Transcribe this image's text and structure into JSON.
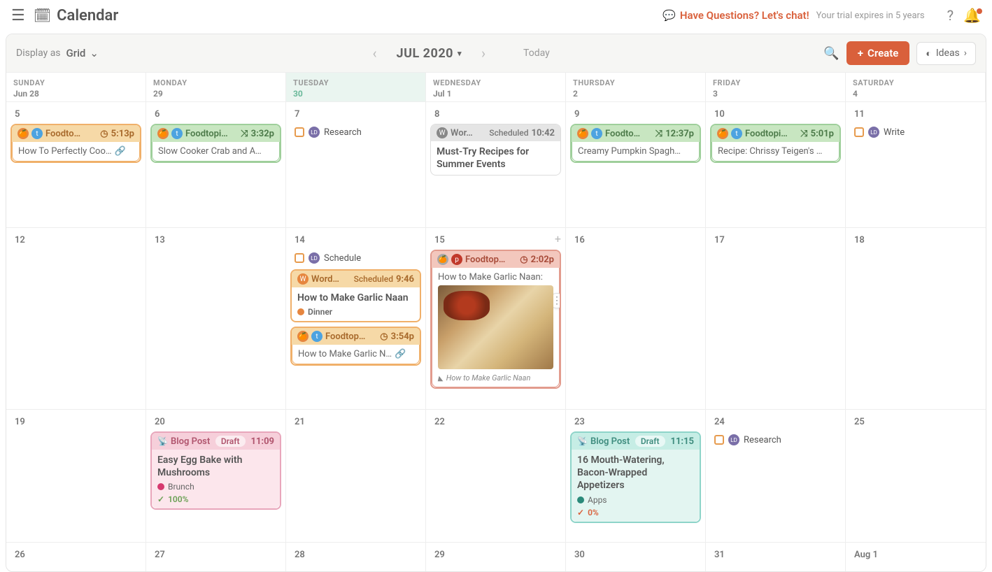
{
  "header": {
    "title": "Calendar",
    "chat": "Have Questions? Let's chat!",
    "trial": "Your trial expires in 5 years"
  },
  "toolbar": {
    "display_label": "Display as",
    "display_value": "Grid",
    "month": "JUL 2020",
    "today": "Today",
    "create": "Create",
    "ideas": "Ideas"
  },
  "week_headers": [
    {
      "name": "SUNDAY",
      "sub": "Jun 28"
    },
    {
      "name": "MONDAY",
      "sub": "29"
    },
    {
      "name": "TUESDAY",
      "sub": "30",
      "today": true
    },
    {
      "name": "WEDNESDAY",
      "sub": "Jul 1"
    },
    {
      "name": "THURSDAY",
      "sub": "2"
    },
    {
      "name": "FRIDAY",
      "sub": "3"
    },
    {
      "name": "SATURDAY",
      "sub": "4"
    }
  ],
  "rows": {
    "r1": [
      "5",
      "6",
      "7",
      "8",
      "9",
      "10",
      "11"
    ],
    "r2": [
      "12",
      "13",
      "14",
      "15",
      "16",
      "17",
      "18"
    ],
    "r3": [
      "19",
      "20",
      "21",
      "22",
      "23",
      "24",
      "25"
    ],
    "r4": [
      "26",
      "27",
      "28",
      "29",
      "30",
      "31",
      "Aug 1"
    ]
  },
  "cards": {
    "d5": {
      "label": "Foodto…",
      "time": "5:13p",
      "body": "How To Perfectly Coo…"
    },
    "d6": {
      "label": "Foodtopi…",
      "time": "3:32p",
      "body": "Slow Cooker Crab and A…"
    },
    "d7": {
      "chip": "Research"
    },
    "d8": {
      "wp_label": "Wor…",
      "wp_status": "Scheduled",
      "wp_time": "10:42",
      "wp_title": "Must-Try Recipes for Summer Events"
    },
    "d9": {
      "label": "Foodto…",
      "time": "12:37p",
      "body": "Creamy Pumpkin Spagh…"
    },
    "d10": {
      "label": "Foodtopi…",
      "time": "5:01p",
      "body": "Recipe: Chrissy Teigen's …"
    },
    "d11": {
      "chip": "Write"
    },
    "d14_chip": "Schedule",
    "d14_wp": {
      "wp_label": "Word…",
      "wp_status": "Scheduled",
      "wp_time": "9:46",
      "wp_title": "How to Make Garlic Naan",
      "tag": "Dinner"
    },
    "d14_s": {
      "label": "Foodtop…",
      "time": "3:54p",
      "body": "How to Make Garlic N…"
    },
    "d15": {
      "label": "Foodtop…",
      "time": "2:02p",
      "body": "How to Make Garlic Naan:",
      "caption": "How to Make Garlic Naan"
    },
    "d20": {
      "blog_label": "Blog Post",
      "status": "Draft",
      "time": "11:09",
      "title": "Easy Egg Bake with Mushrooms",
      "tag": "Brunch",
      "progress": "100%"
    },
    "d23": {
      "blog_label": "Blog Post",
      "status": "Draft",
      "time": "11:15",
      "title": "16 Mouth-Watering, Bacon-Wrapped Appetizers",
      "tag": "Apps",
      "progress": "0%"
    },
    "d24": {
      "chip": "Research"
    }
  }
}
